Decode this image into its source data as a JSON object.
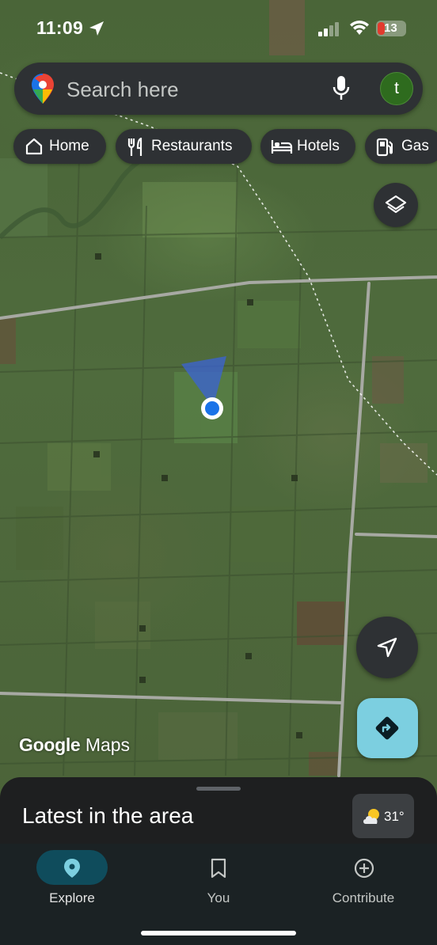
{
  "status_bar": {
    "time": "11:09",
    "battery_level": "13",
    "icons": [
      "location-arrow-icon",
      "signal-icon",
      "wifi-icon",
      "battery-icon"
    ]
  },
  "search": {
    "placeholder": "Search here",
    "avatar_initial": "t"
  },
  "chips": [
    {
      "label": "Home",
      "icon": "home-icon"
    },
    {
      "label": "Restaurants",
      "icon": "fork-knife-icon"
    },
    {
      "label": "Hotels",
      "icon": "bed-icon"
    },
    {
      "label": "Gas",
      "icon": "fuel-pump-icon"
    }
  ],
  "map": {
    "watermark_brand": "Google",
    "watermark_product": "Maps"
  },
  "sheet": {
    "title": "Latest in the area",
    "temperature": "31°",
    "weather_icon": "partly-cloudy-icon"
  },
  "nav": [
    {
      "label": "Explore",
      "icon": "pin-icon",
      "active": true
    },
    {
      "label": "You",
      "icon": "bookmark-icon",
      "active": false
    },
    {
      "label": "Contribute",
      "icon": "add-circle-icon",
      "active": false
    }
  ],
  "colors": {
    "directions_button": "#7ccfe0",
    "location_dot": "#1a73e8",
    "active_nav": "#0f4c5c"
  }
}
